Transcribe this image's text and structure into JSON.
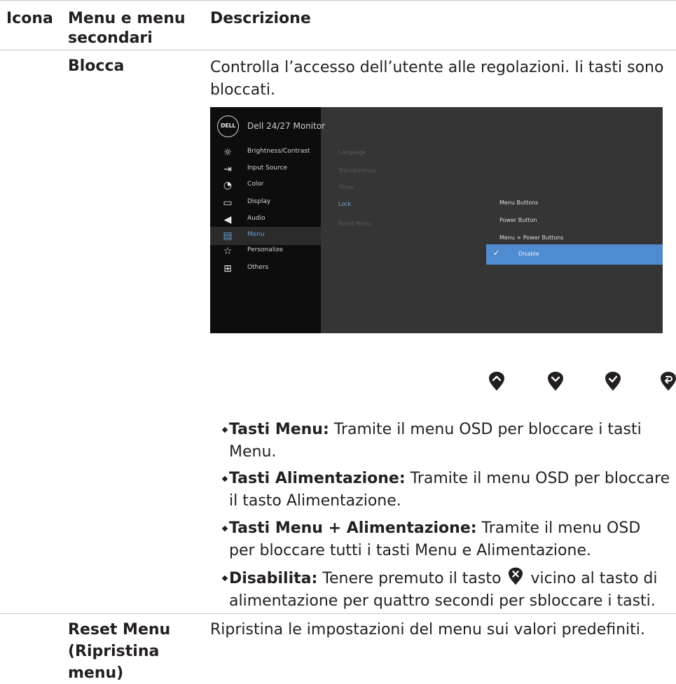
{
  "table": {
    "headers": {
      "icon": "Icona",
      "menu": "Menu e menu secondari",
      "desc": "Descrizione"
    },
    "rows": [
      {
        "name": "Blocca",
        "description": "Controlla l’accesso dell’utente alle regolazioni. Ii tasti sono bloccati.",
        "bullets": [
          {
            "term": "Tasti Menu:",
            "text": " Tramite il menu OSD per bloccare i tasti Menu."
          },
          {
            "term": "Tasti Alimentazione:",
            "text": " Tramite il menu OSD per bloccare il tasto Alimentazione."
          },
          {
            "term": "Tasti Menu + Alimentazione:",
            "text": " Tramite il menu OSD per bloccare tutti i tasti Menu e Alimentazione."
          },
          {
            "term": "Disabilita:",
            "text_before": " Tenere premuto il tasto",
            "text_after": " vicino al tasto di alimentazione per quattro secondi per sbloccare i tasti."
          }
        ]
      },
      {
        "name": "Reset Menu (Ripristina menu)",
        "description": "Ripristina le impostazioni del menu sui valori predefiniti."
      }
    ]
  },
  "osd": {
    "logo": "DELL",
    "title": "Dell 24/27 Monitor",
    "menu": [
      {
        "label": "Brightness/Contrast",
        "icon": "brightness-icon"
      },
      {
        "label": "Input Source",
        "icon": "input-source-icon"
      },
      {
        "label": "Color",
        "icon": "color-icon"
      },
      {
        "label": "Display",
        "icon": "display-icon"
      },
      {
        "label": "Audio",
        "icon": "audio-icon"
      },
      {
        "label": "Menu",
        "icon": "menu-icon",
        "active": true
      },
      {
        "label": "Personalize",
        "icon": "star-icon"
      },
      {
        "label": "Others",
        "icon": "others-icon"
      }
    ],
    "submenu": [
      "Language",
      "Transparency",
      "Timer",
      "Lock",
      "Reset Menu"
    ],
    "active_submenu": "Lock",
    "options": [
      "Menu Buttons",
      "Power Button",
      "Menu + Power Buttons",
      "Disable"
    ],
    "selected_option": "Disable",
    "colors": {
      "highlight": "#4f8bd0",
      "panel": "#353535",
      "sidebar": "#0d0d0d"
    }
  },
  "nav_buttons": [
    "up-icon",
    "down-icon",
    "check-icon",
    "back-icon"
  ]
}
